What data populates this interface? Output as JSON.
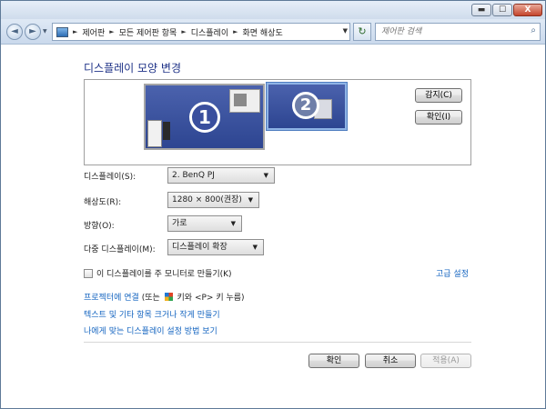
{
  "titlebar": {
    "minimize_label": "▬",
    "maximize_label": "☐",
    "close_label": "X"
  },
  "nav": {
    "back_label": "◄",
    "forward_label": "►",
    "history_label": "▼"
  },
  "address": {
    "crumbs": [
      "제어판",
      "모든 제어판 항목",
      "디스플레이",
      "화면 해상도"
    ],
    "dropdown_label": "▼",
    "refresh_label": "↻"
  },
  "search": {
    "placeholder": "제어판 검색",
    "icon_label": "⌕"
  },
  "page": {
    "heading": "디스플레이 모양 변경",
    "monitors": [
      {
        "number": "1"
      },
      {
        "number": "2"
      }
    ],
    "detect_label": "감지(C)",
    "identify_label": "확인(I)"
  },
  "settings": {
    "display": {
      "label": "디스플레이(S):",
      "value": "2. BenQ PJ"
    },
    "resolution": {
      "label": "해상도(R):",
      "value": "1280 × 800(권장)"
    },
    "orientation": {
      "label": "방향(O):",
      "value": "가로"
    },
    "multiple": {
      "label": "다중 디스플레이(M):",
      "value": "디스플레이 확장"
    }
  },
  "main_display_checkbox": {
    "label": "이 디스플레이를 주 모니터로 만들기(K)",
    "checked": false
  },
  "advanced_link": "고급 설정",
  "links": {
    "projector_link": "프로젝터에 연결",
    "projector_note": "(또는",
    "projector_note_after": "키와 <P> 키 누름)",
    "text_size": "텍스트 및 기타 항목 크거나 작게 만들기",
    "help": "나에게 맞는 디스플레이 설정 방법 보기"
  },
  "footer": {
    "ok_label": "확인",
    "cancel_label": "취소",
    "apply_label": "적용(A)"
  }
}
